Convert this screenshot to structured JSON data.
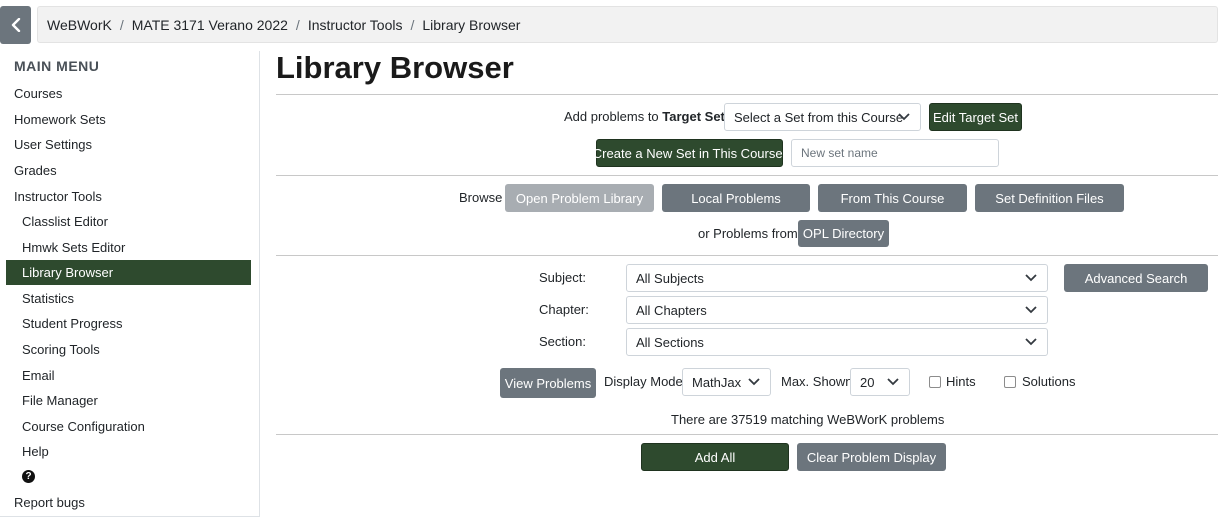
{
  "breadcrumb": {
    "items": [
      "WeBWorK",
      "MATE 3171 Verano 2022",
      "Instructor Tools",
      "Library Browser"
    ],
    "separator": "/"
  },
  "sidebar": {
    "title": "MAIN MENU",
    "items": [
      {
        "label": "Courses"
      },
      {
        "label": "Homework Sets"
      },
      {
        "label": "User Settings"
      },
      {
        "label": "Grades"
      },
      {
        "label": "Instructor Tools"
      },
      {
        "label": "Classlist Editor"
      },
      {
        "label": "Hmwk Sets Editor"
      },
      {
        "label": "Library Browser"
      },
      {
        "label": "Statistics"
      },
      {
        "label": "Student Progress"
      },
      {
        "label": "Scoring Tools"
      },
      {
        "label": "Email"
      },
      {
        "label": "File Manager"
      },
      {
        "label": "Course Configuration"
      },
      {
        "label": "Help"
      },
      {
        "label": "Report bugs"
      }
    ],
    "help_icon_glyph": "?"
  },
  "page_title": "Library Browser",
  "target_set": {
    "label_prefix": "Add problems to ",
    "label_bold": "Target Set:",
    "select_value": "Select a Set from this Course",
    "edit_button": "Edit Target Set",
    "create_button": "Create a New Set in This Course:",
    "new_set_placeholder": "New set name"
  },
  "browse": {
    "label": "Browse",
    "tabs": [
      "Open Problem Library",
      "Local Problems",
      "From This Course",
      "Set Definition Files"
    ],
    "or_label": "or Problems from",
    "opl_button": "OPL Directory"
  },
  "filters": {
    "subject_label": "Subject:",
    "subject_value": "All Subjects",
    "chapter_label": "Chapter:",
    "chapter_value": "All Chapters",
    "section_label": "Section:",
    "section_value": "All Sections",
    "advanced_button": "Advanced Search"
  },
  "view": {
    "view_button": "View Problems",
    "display_mode_label": "Display Mode:",
    "display_mode_value": "MathJax",
    "max_shown_label": "Max. Shown:",
    "max_shown_value": "20",
    "hints_label": "Hints",
    "solutions_label": "Solutions"
  },
  "status": "There are 37519 matching WeBWorK problems",
  "actions": {
    "add_all": "Add All",
    "clear_display": "Clear Problem Display"
  },
  "colors": {
    "accent_dark_green": "#2e4a2e",
    "button_grey": "#6c757d",
    "button_disabled": "#a8adb2"
  }
}
